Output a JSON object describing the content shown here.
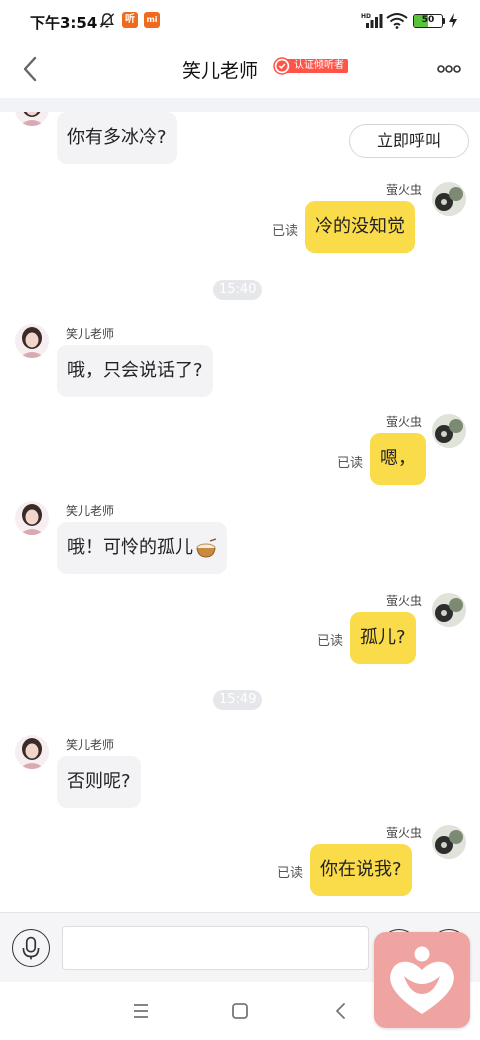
{
  "status_bar": {
    "time": "下午3:54",
    "app_icon_1": "听",
    "app_icon_2": "mi",
    "battery": "50"
  },
  "header": {
    "title": "笑儿老师",
    "verified_label": "认证倾听者"
  },
  "chat": {
    "call_button": "立即呼叫",
    "teacher_name": "笑儿老师",
    "user_name": "萤火虫",
    "read_label": "已读",
    "messages": [
      {
        "side": "left",
        "text": "你有多冰冷?"
      },
      {
        "side": "right",
        "text": "冷的没知觉"
      },
      {
        "side": "time",
        "text": "15:40"
      },
      {
        "side": "left",
        "text": "哦，只会说话了?"
      },
      {
        "side": "right",
        "text": "嗯，"
      },
      {
        "side": "left",
        "text": "哦！可怜的孤儿",
        "emoji": "bowl-emoji"
      },
      {
        "side": "right",
        "text": "孤儿?"
      },
      {
        "side": "time",
        "text": "15:49"
      },
      {
        "side": "left",
        "text": "否则呢?"
      },
      {
        "side": "right",
        "text": "你在说我?"
      }
    ]
  },
  "input": {
    "placeholder": ""
  },
  "colors": {
    "user_bubble": "#fadb4a",
    "teacher_bubble": "#f3f3f6",
    "verified_badge": "#ff5448",
    "float_app": "#f0a4a2"
  }
}
